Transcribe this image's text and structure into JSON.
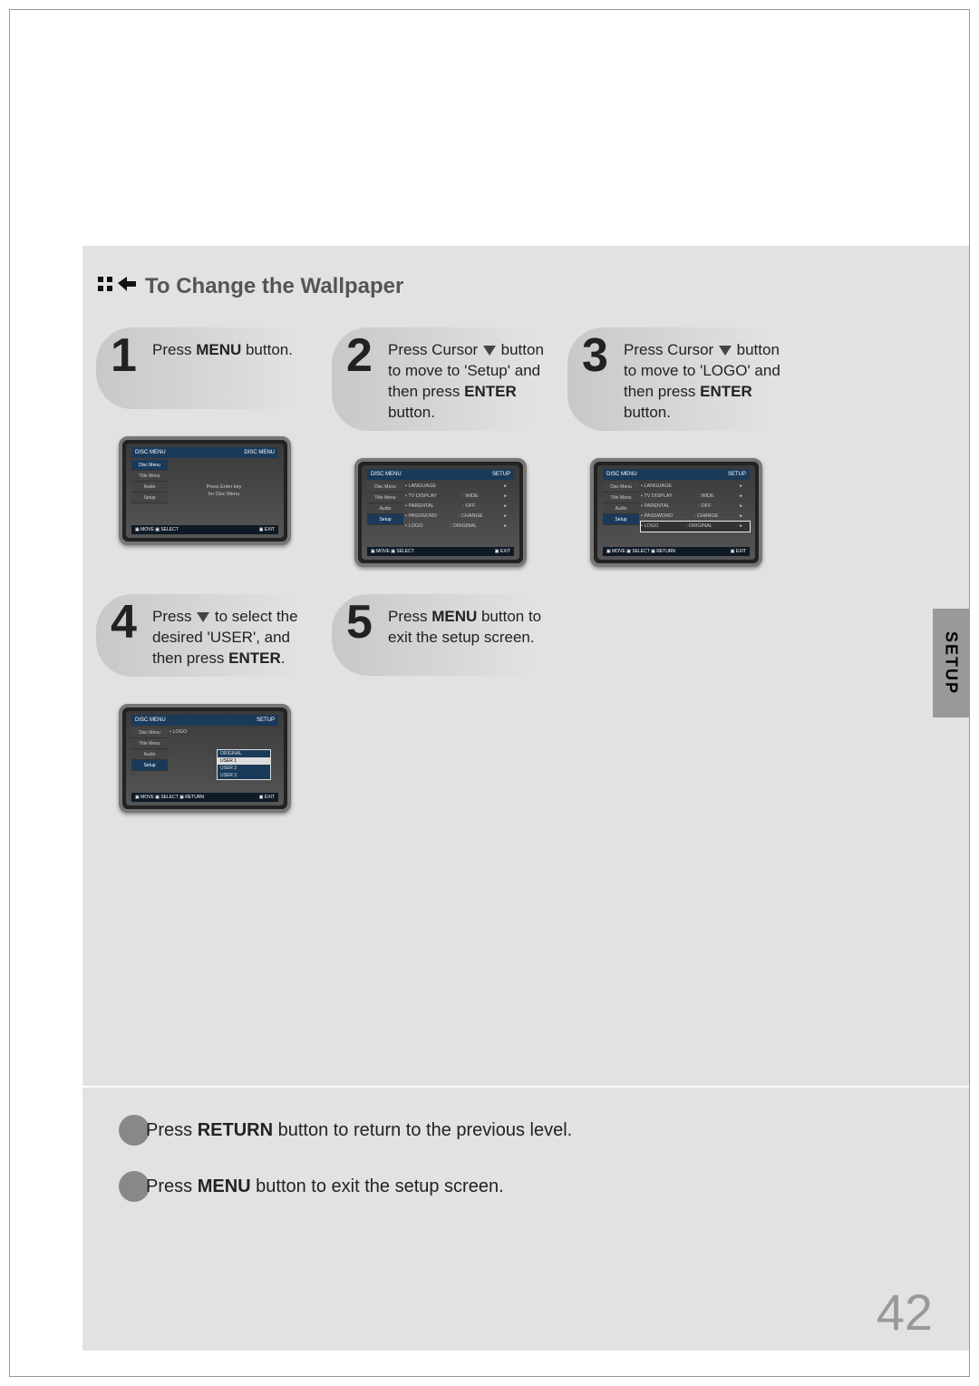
{
  "heading": "To Change the Wallpaper",
  "sideTab": "SETUP",
  "pageNumber": "42",
  "steps": [
    {
      "num": "1",
      "html": "Press <b>MENU</b> button."
    },
    {
      "num": "2",
      "html": "Press Cursor <span class='down-tri'></span> button to move to 'Setup' and then press <b>ENTER</b> button."
    },
    {
      "num": "3",
      "html": "Press Cursor <span class='down-tri'></span> button to move to 'LOGO' and then press <b>ENTER</b> button."
    },
    {
      "num": "4",
      "html": "Press <span class='down-tri'></span> to select the desired 'USER', and then press <b>ENTER</b>."
    },
    {
      "num": "5",
      "html": "Press <b>MENU</b> button to exit the setup screen."
    }
  ],
  "screens": {
    "s1": {
      "leftTitle": "DISC MENU",
      "rightTitle": "DISC MENU",
      "side": [
        "Disc Menu",
        "Title Menu",
        "Audio",
        "Setup"
      ],
      "sideSelIdx": 0,
      "mainCenter": [
        "Press Enter key",
        "for Disc Menu"
      ],
      "footer": {
        "left": [
          "MOVE",
          "SELECT"
        ],
        "right": [
          "EXIT"
        ]
      }
    },
    "s2": {
      "leftTitle": "DISC MENU",
      "rightTitle": "SETUP",
      "side": [
        "Disc Menu",
        "Title Menu",
        "Audio",
        "Setup"
      ],
      "sideSelIdx": 3,
      "rows": [
        [
          "• LANGUAGE",
          "",
          "▸"
        ],
        [
          "• TV DISPLAY",
          ": WIDE",
          "▸"
        ],
        [
          "• PARENTAL",
          ": OFF",
          "▸"
        ],
        [
          "• PASSWORD",
          ": CHANGE",
          "▸"
        ],
        [
          "• LOGO",
          ": ORIGINAL",
          "▸"
        ]
      ],
      "footer": {
        "left": [
          "MOVE",
          "SELECT"
        ],
        "right": [
          "EXIT"
        ]
      }
    },
    "s3": {
      "leftTitle": "DISC MENU",
      "rightTitle": "SETUP",
      "side": [
        "Disc Menu",
        "Title Menu",
        "Audio",
        "Setup"
      ],
      "sideSelIdx": 3,
      "rows": [
        [
          "• LANGUAGE",
          "",
          "▸"
        ],
        [
          "• TV DISPLAY",
          ": WIDE",
          "▸"
        ],
        [
          "• PARENTAL",
          ": OFF",
          "▸"
        ],
        [
          "• PASSWORD",
          ": CHANGE",
          "▸"
        ],
        [
          "• LOGO",
          ": ORIGINAL",
          "▸"
        ]
      ],
      "hlRow": 4,
      "footer": {
        "left": [
          "MOVE",
          "SELECT",
          "RETURN"
        ],
        "right": [
          "EXIT"
        ]
      }
    },
    "s4": {
      "leftTitle": "DISC MENU",
      "rightTitle": "SETUP",
      "side": [
        "Disc Menu",
        "Title Menu",
        "Audio",
        "Setup"
      ],
      "sideSelIdx": 3,
      "mainLabel": "• LOGO",
      "popup": [
        "ORIGINAL",
        "USER 1",
        "USER 2",
        "USER 3"
      ],
      "popupSelIdx": 1,
      "footer": {
        "left": [
          "MOVE",
          "SELECT",
          "RETURN"
        ],
        "right": [
          "EXIT"
        ]
      }
    }
  },
  "footerNotes": [
    "Press <b>RETURN</b> button to return to the previous level.",
    "Press <b>MENU</b> button to exit the setup screen."
  ]
}
